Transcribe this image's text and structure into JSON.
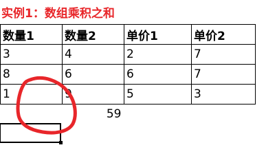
{
  "title": "实例1：数组乘积之和",
  "table": {
    "headers": [
      "数量1",
      "数量2",
      "单价1",
      "单价2"
    ],
    "rows": [
      [
        "3",
        "4",
        "2",
        "7"
      ],
      [
        "8",
        "6",
        "6",
        "7"
      ],
      [
        "1",
        "9",
        "5",
        "3"
      ]
    ],
    "result": "59"
  },
  "colors": {
    "title": "#e8262a",
    "annotation": "#e8262a",
    "grid": "#000000"
  }
}
